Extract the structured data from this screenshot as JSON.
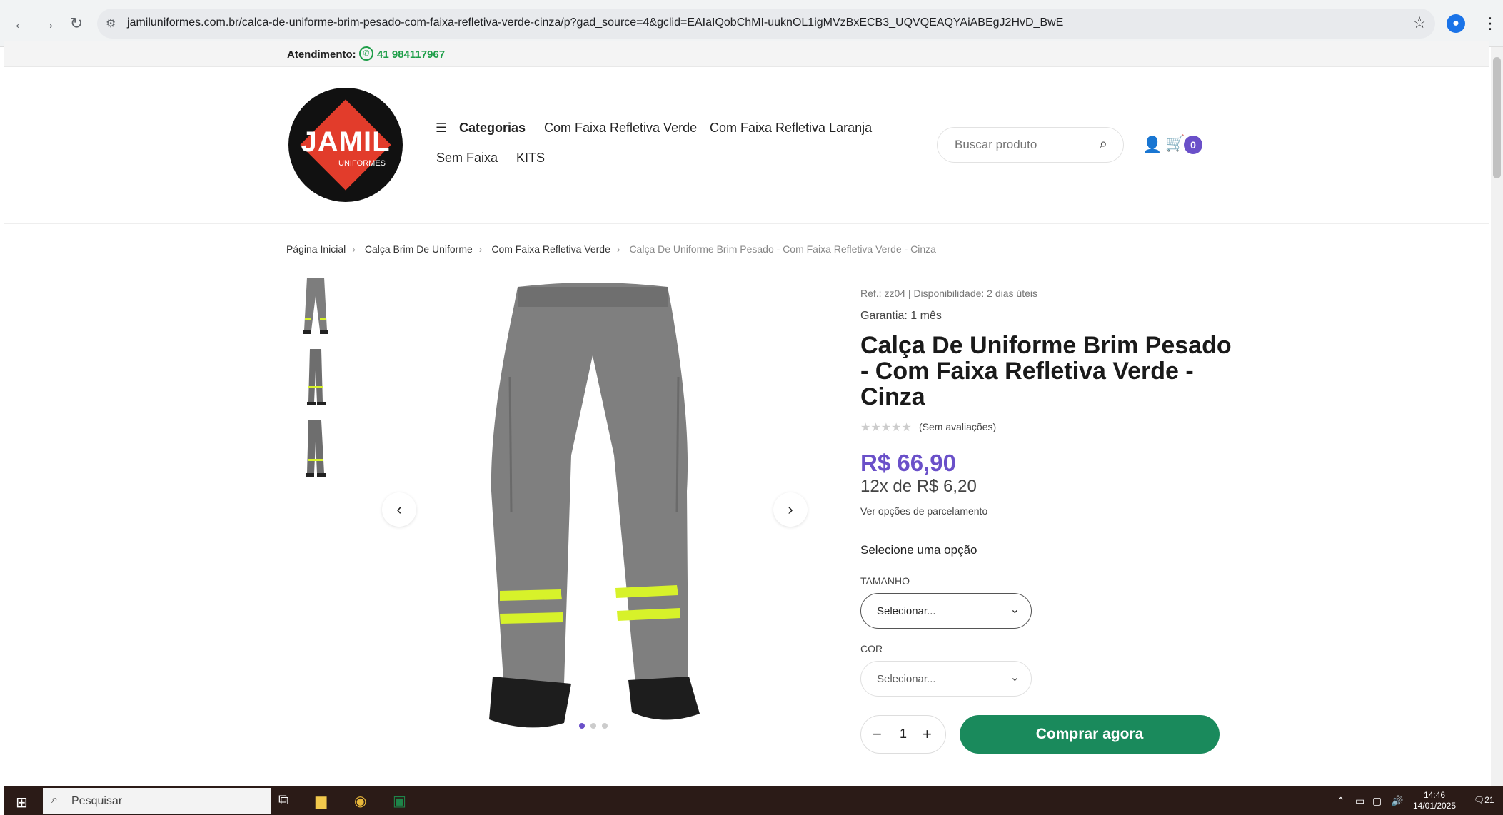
{
  "browser": {
    "url": "jamiluniformes.com.br/calca-de-uniforme-brim-pesado-com-faixa-refletiva-verde-cinza/p?gad_source=4&gclid=EAIaIQobChMI-uuknOL1igMVzBxECB3_UQVQEAQYAiABEgJ2HvD_BwE",
    "icons": [
      "back-icon",
      "forward-icon",
      "reload-icon",
      "site-info-icon",
      "star-icon",
      "profile-icon",
      "menu-icon"
    ]
  },
  "topstrip": {
    "label": "Atendimento:",
    "phone": "41 984117967"
  },
  "logo": {
    "name": "JAMIL",
    "sub": "UNIFORMES"
  },
  "nav": {
    "categories": "Categorias",
    "items": [
      "Com Faixa Refletiva Verde",
      "Com Faixa Refletiva Laranja",
      "Sem Faixa",
      "KITS"
    ]
  },
  "search": {
    "placeholder": "Buscar produto"
  },
  "cart": {
    "count": "0"
  },
  "breadcrumb": {
    "items": [
      "Página Inicial",
      "Calça Brim De Uniforme",
      "Com Faixa Refletiva Verde"
    ],
    "current": "Calça De Uniforme Brim Pesado - Com Faixa Refletiva Verde - Cinza"
  },
  "gallery": {
    "thumb_count": 3,
    "active_dot": 0,
    "dots": 3
  },
  "product": {
    "ref": "Ref.: zz04 | Disponibilidade: 2 dias úteis",
    "garantia": "Garantia: 1 mês",
    "title": "Calça De Uniforme Brim Pesado - Com Faixa Refletiva Verde - Cinza",
    "rating": 0,
    "reviews": "(Sem avaliações)",
    "price": "R$ 66,90",
    "installments": "12x de R$ 6,20",
    "installment_link": "Ver opções de parcelamento",
    "select_prompt": "Selecione uma opção",
    "size_label": "TAMANHO",
    "size_value": "Selecionar...",
    "color_label": "COR",
    "color_value": "Selecionar...",
    "quantity": "1",
    "buy_label": "Comprar agora"
  },
  "colors": {
    "accent": "#6a50c9",
    "buy": "#1a8a5c",
    "whatsapp": "#1e9e48"
  },
  "taskbar": {
    "search_placeholder": "Pesquisar",
    "time": "14:46",
    "date": "14/01/2025",
    "notifications": "21"
  }
}
